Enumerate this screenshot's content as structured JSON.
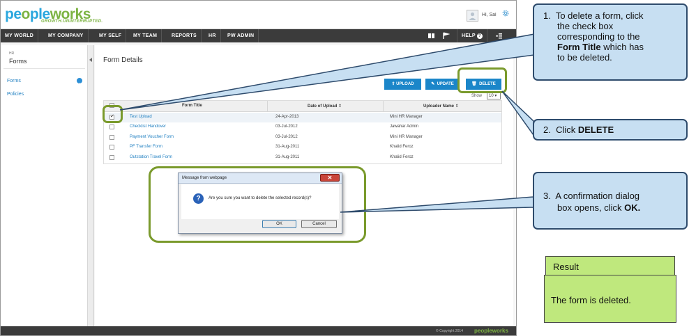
{
  "app": {
    "logo_a": "pe",
    "logo_b": "ple",
    "logo_c": "works",
    "tagline": "GROWTH.UNINTERRUPTED.",
    "greeting": "Hi, Sai"
  },
  "nav": {
    "items": [
      "MY WORLD",
      "MY COMPANY",
      "MY SELF",
      "MY TEAM",
      "REPORTS",
      "HR",
      "PW ADMIN"
    ],
    "help": "HELP"
  },
  "sidebar": {
    "section": "HR",
    "title": "Forms",
    "items": [
      "Forms",
      "Policies"
    ]
  },
  "page": {
    "title": "Form Details",
    "buttons": {
      "upload": "UPLOAD",
      "update": "UPDATE",
      "delete": "DELETE"
    },
    "show_label": "Show",
    "show_value": "10"
  },
  "table": {
    "columns": [
      "Form Title",
      "Date of Upload",
      "Uploader Name"
    ],
    "rows": [
      {
        "title": "Test Upload",
        "date": "24-Apr-2013",
        "uploader": "Mini HR Manager",
        "checked": true
      },
      {
        "title": "Checklist Handover",
        "date": "03-Jul-2012",
        "uploader": "Jawahar Admin",
        "checked": false
      },
      {
        "title": "Payment Voucher Form",
        "date": "03-Jul-2012",
        "uploader": "Mini HR Manager",
        "checked": false
      },
      {
        "title": "PF Transfer Form",
        "date": "31-Aug-2011",
        "uploader": "Khalid Feroz",
        "checked": false
      },
      {
        "title": "Outstation Travel Form",
        "date": "31-Aug-2011",
        "uploader": "Khalid Feroz",
        "checked": false
      }
    ]
  },
  "dialog": {
    "title": "Message from webpage",
    "message": "Are you sure you want to delete the selected record(s)?",
    "ok": "OK",
    "cancel": "Cancel"
  },
  "footer": {
    "copyright": "© Copyright 2014",
    "logo": "peopleworks"
  },
  "callouts": {
    "c1_num": "1.",
    "c1_line1": "To delete a form, click",
    "c1_line2": "the check box",
    "c1_line3": "corresponding to the",
    "c1_bold": "Form Title",
    "c1_line4_rest": " which has",
    "c1_line5": "to be deleted.",
    "c2_num": "2.",
    "c2_text": "Click ",
    "c2_bold": "DELETE",
    "c3_num": "3.",
    "c3_line1": "A confirmation dialog",
    "c3_line2": "box opens, click ",
    "c3_bold": "OK."
  },
  "result": {
    "heading": "Result",
    "text": "The form is deleted."
  },
  "colors": {
    "brand_blue": "#2aa7de",
    "brand_green": "#7cb342",
    "nav_bg": "#3b3b3b",
    "button_blue": "#1b86c9",
    "callout_bg": "#c7dff2",
    "highlight_green": "#7a9a2c",
    "result_green": "#bfe87d"
  }
}
